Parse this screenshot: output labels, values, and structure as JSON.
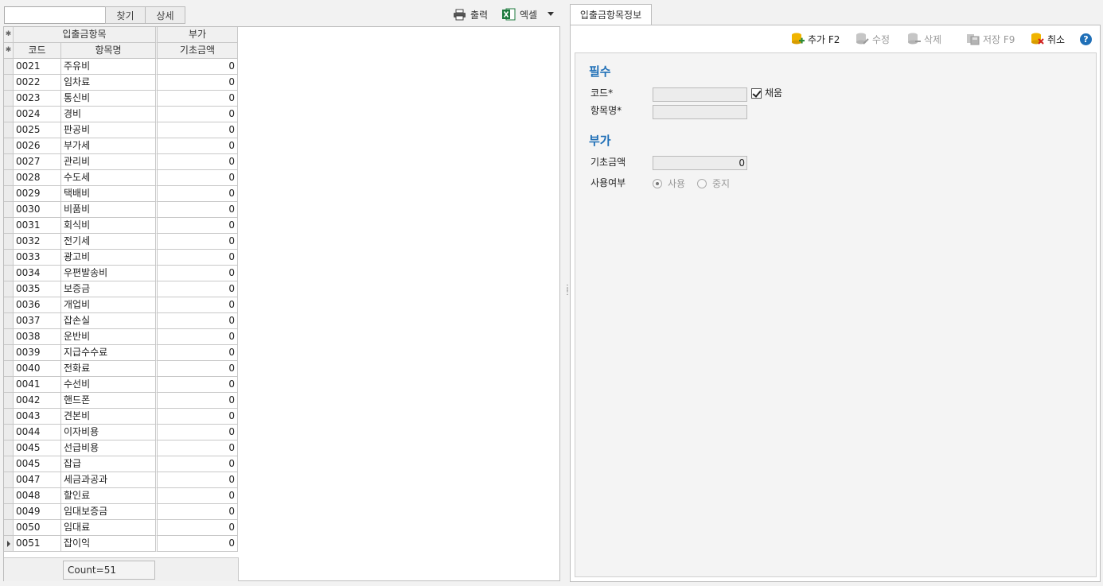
{
  "search": {
    "value": "",
    "find_label": "찾기",
    "detail_label": "상세"
  },
  "toolbar_left": {
    "print_label": "출력",
    "excel_label": "엑셀"
  },
  "grid": {
    "band_main": "입출금항목",
    "band_sub": "부가",
    "col_code": "코드",
    "col_name": "항목명",
    "col_amount": "기초금액",
    "rows": [
      {
        "code": "0021",
        "name": "주유비",
        "amount": "0"
      },
      {
        "code": "0022",
        "name": "임차료",
        "amount": "0"
      },
      {
        "code": "0023",
        "name": "통신비",
        "amount": "0"
      },
      {
        "code": "0024",
        "name": "경비",
        "amount": "0"
      },
      {
        "code": "0025",
        "name": "판공비",
        "amount": "0"
      },
      {
        "code": "0026",
        "name": "부가세",
        "amount": "0"
      },
      {
        "code": "0027",
        "name": "관리비",
        "amount": "0"
      },
      {
        "code": "0028",
        "name": "수도세",
        "amount": "0"
      },
      {
        "code": "0029",
        "name": "택배비",
        "amount": "0"
      },
      {
        "code": "0030",
        "name": "비품비",
        "amount": "0"
      },
      {
        "code": "0031",
        "name": "회식비",
        "amount": "0"
      },
      {
        "code": "0032",
        "name": "전기세",
        "amount": "0"
      },
      {
        "code": "0033",
        "name": "광고비",
        "amount": "0"
      },
      {
        "code": "0034",
        "name": "우편발송비",
        "amount": "0"
      },
      {
        "code": "0035",
        "name": "보증금",
        "amount": "0"
      },
      {
        "code": "0036",
        "name": "개업비",
        "amount": "0"
      },
      {
        "code": "0037",
        "name": "잡손실",
        "amount": "0"
      },
      {
        "code": "0038",
        "name": "운반비",
        "amount": "0"
      },
      {
        "code": "0039",
        "name": "지급수수료",
        "amount": "0"
      },
      {
        "code": "0040",
        "name": "전화료",
        "amount": "0"
      },
      {
        "code": "0041",
        "name": "수선비",
        "amount": "0"
      },
      {
        "code": "0042",
        "name": "핸드폰",
        "amount": "0"
      },
      {
        "code": "0043",
        "name": "견본비",
        "amount": "0"
      },
      {
        "code": "0044",
        "name": "이자비용",
        "amount": "0"
      },
      {
        "code": "0045",
        "name": "선급비용",
        "amount": "0"
      },
      {
        "code": "0045",
        "name": "잡급",
        "amount": "0"
      },
      {
        "code": "0047",
        "name": "세금과공과",
        "amount": "0"
      },
      {
        "code": "0048",
        "name": "할인료",
        "amount": "0"
      },
      {
        "code": "0049",
        "name": "임대보증금",
        "amount": "0"
      },
      {
        "code": "0050",
        "name": "임대료",
        "amount": "0"
      },
      {
        "code": "0051",
        "name": "잡이익",
        "amount": "0"
      }
    ],
    "count_text": "Count=51"
  },
  "right": {
    "tab_label": "입출금항목정보",
    "toolbar": {
      "add_label": "추가 F2",
      "edit_label": "수정",
      "delete_label": "삭제",
      "save_label": "저장 F9",
      "cancel_label": "취소",
      "help_label": "?"
    },
    "section_required": "필수",
    "code_label": "코드*",
    "code_value": "",
    "auto_fill_label": "채움",
    "name_label": "항목명*",
    "name_value": "",
    "section_extra": "부가",
    "amount_label": "기초금액",
    "amount_value": "0",
    "usage_label": "사용여부",
    "use_option": "사용",
    "stop_option": "중지"
  },
  "colors": {
    "accent": "#1f6fb7",
    "border": "#bdbdbd",
    "help": "#1f6fb7"
  }
}
